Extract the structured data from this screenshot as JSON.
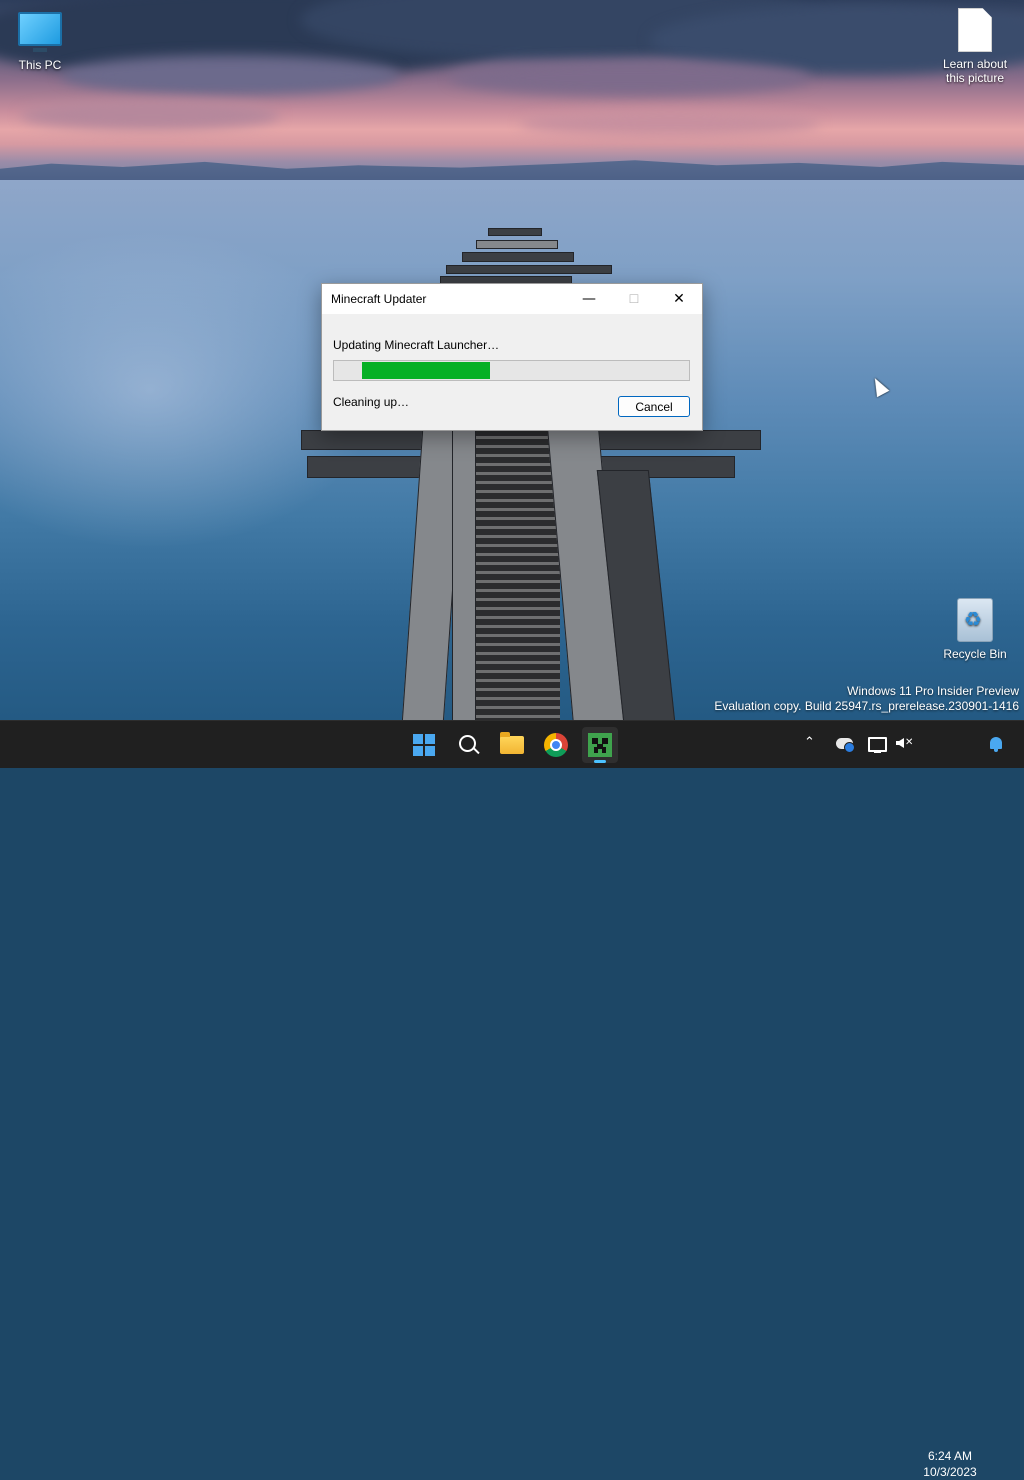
{
  "desktop": {
    "icons": [
      {
        "label": "This PC",
        "icon": "monitor-icon"
      },
      {
        "label": "Learn about\nthis picture",
        "icon": "document-icon"
      },
      {
        "label": "Recycle Bin",
        "icon": "recycle-bin-icon"
      }
    ],
    "watermark": {
      "line1": "Windows 11 Pro Insider Preview",
      "line2": "Evaluation copy. Build 25947.rs_prerelease.230901-1416"
    }
  },
  "dialog": {
    "title": "Minecraft Updater",
    "controls": {
      "minimize": "—",
      "maximize": "☐",
      "close": "✕"
    },
    "status_text": "Updating Minecraft Launcher…",
    "progress": {
      "start_fraction": 0.08,
      "end_fraction": 0.44,
      "color": "#06b025"
    },
    "detail_text": "Cleaning up…",
    "cancel_label": "Cancel"
  },
  "taskbar": {
    "pinned": [
      {
        "name": "start-button",
        "icon": "windows-logo-icon"
      },
      {
        "name": "search-button",
        "icon": "search-icon"
      },
      {
        "name": "file-explorer",
        "icon": "folder-icon"
      },
      {
        "name": "google-chrome",
        "icon": "chrome-icon"
      },
      {
        "name": "minecraft-launcher",
        "icon": "creeper-icon",
        "active": true
      }
    ],
    "tray": {
      "overflow_glyph": "⌃",
      "clock_time": "6:24 AM",
      "clock_date": "10/3/2023"
    },
    "accent_color": "#4cc2ff"
  }
}
